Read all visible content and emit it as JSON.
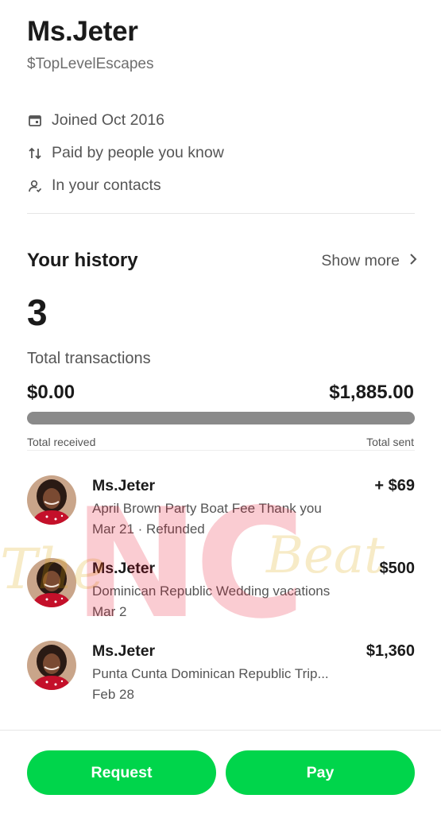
{
  "profile": {
    "name": "Ms.Jeter",
    "handle": "$TopLevelEscapes"
  },
  "meta": [
    {
      "icon": "calendar-icon",
      "text": "Joined Oct 2016"
    },
    {
      "icon": "arrows-up-down-icon",
      "text": "Paid by people you know"
    },
    {
      "icon": "contact-icon",
      "text": "In your contacts"
    }
  ],
  "history": {
    "title": "Your history",
    "show_more": "Show more",
    "count": "3",
    "count_label": "Total transactions",
    "received_amount": "$0.00",
    "sent_amount": "$1,885.00",
    "received_label": "Total received",
    "sent_label": "Total sent",
    "received_fraction": 0
  },
  "transactions": [
    {
      "name": "Ms.Jeter",
      "desc": "April Brown Party Boat Fee Thank you",
      "date": "Mar 21 · Refunded",
      "amount": "+ $69"
    },
    {
      "name": "Ms.Jeter",
      "desc": "Dominican Republic Wedding vacations",
      "date": "Mar 2",
      "amount": "$500"
    },
    {
      "name": "Ms.Jeter",
      "desc": "Punta Cunta Dominican Republic Trip...",
      "date": "Feb 28",
      "amount": "$1,360"
    }
  ],
  "actions": {
    "request_label": "Request",
    "pay_label": "Pay"
  },
  "watermark": {
    "text": "NC",
    "script_left": "The",
    "script_right": "Beat"
  },
  "colors": {
    "accent": "#00d54b",
    "bar_track": "#8a8a8a",
    "watermark_red": "#e8001c",
    "watermark_gold": "#d9a300"
  }
}
